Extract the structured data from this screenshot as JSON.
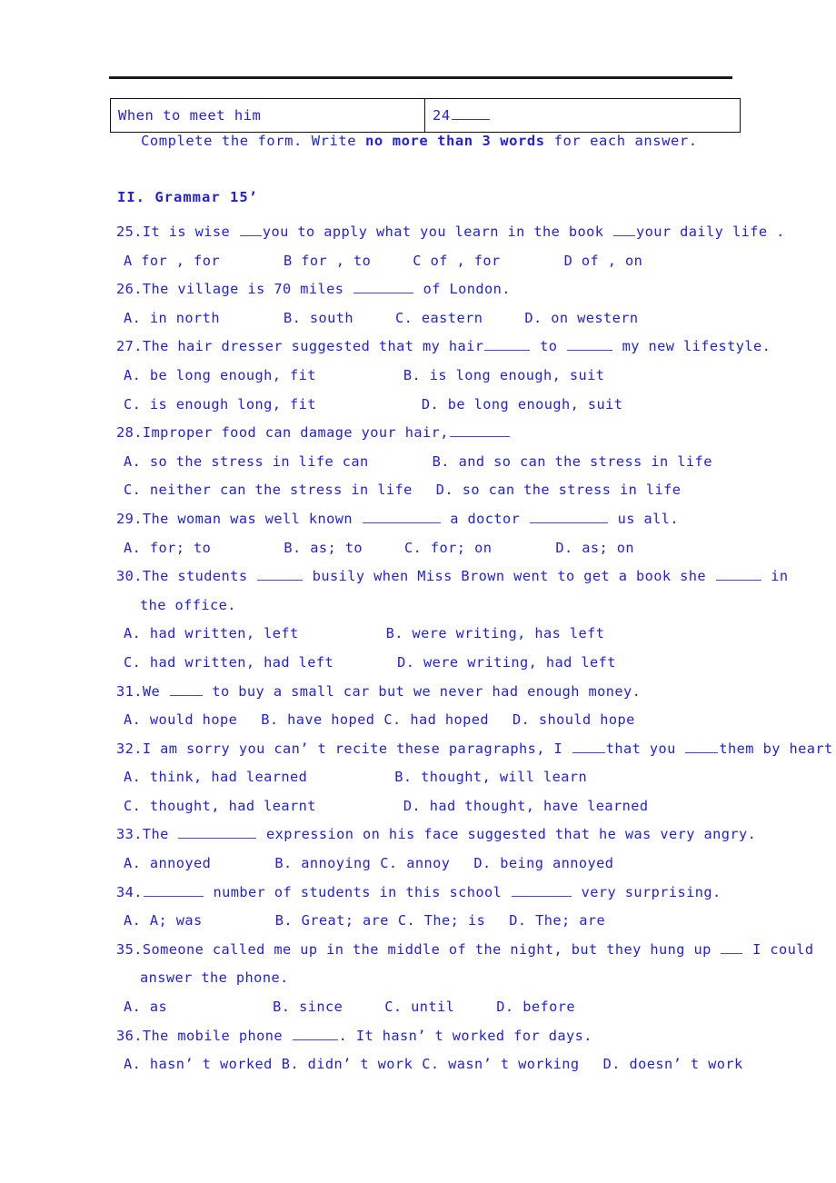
{
  "document": {
    "divider": "horizontal-rule",
    "text_color": "#2222dd",
    "table_border_color": "#111111"
  },
  "form_table": {
    "row": {
      "label": "When to meet him",
      "answer_number": "24"
    }
  },
  "instruction": {
    "before_bold": "Complete the form. Write ",
    "bold": "no more than 3 words",
    "after_bold": " for each answer."
  },
  "section": {
    "heading": "II. Grammar  15’"
  },
  "questions": [
    {
      "number": "25.",
      "stem_before": "It is wise ",
      "stem_mid": "you to apply what you learn in the book ",
      "stem_after": "your daily life .",
      "options_lines": [
        [
          {
            "label": "A",
            "text": "for , for"
          },
          {
            "label": "B",
            "text": "for , to"
          },
          {
            "label": "C",
            "text": "of , for"
          },
          {
            "label": "D",
            "text": "of , on"
          }
        ]
      ]
    },
    {
      "number": "26.",
      "stem_before": "The village is 70 miles ",
      "stem_after": " of London.",
      "options_lines": [
        [
          {
            "label": "A.",
            "text": "in north"
          },
          {
            "label": "B.",
            "text": "south"
          },
          {
            "label": "C.",
            "text": "eastern"
          },
          {
            "label": "D.",
            "text": "on western"
          }
        ]
      ]
    },
    {
      "number": "27.",
      "stem_before": "The hair dresser suggested that my hair",
      "stem_mid": " to ",
      "stem_after": " my new lifestyle.",
      "options_lines": [
        [
          {
            "label": "A.",
            "text": "be long enough, fit"
          },
          {
            "label": "B.",
            "text": "is long enough, suit"
          }
        ],
        [
          {
            "label": "C.",
            "text": "is enough long, fit"
          },
          {
            "label": "D.",
            "text": "be long enough, suit"
          }
        ]
      ]
    },
    {
      "number": "28.",
      "stem_before": "Improper food can damage your hair,",
      "stem_after": "",
      "options_lines": [
        [
          {
            "label": "A.",
            "text": "so the stress in life can"
          },
          {
            "label": "B.",
            "text": "and so can the stress in life"
          }
        ],
        [
          {
            "label": "C.",
            "text": "neither can the stress in life"
          },
          {
            "label": "D.",
            "text": "so can the stress in life"
          }
        ]
      ]
    },
    {
      "number": "29.",
      "stem_before": "The woman was well known ",
      "stem_mid": " a doctor ",
      "stem_after": " us all.",
      "options_lines": [
        [
          {
            "label": "A.",
            "text": "for; to"
          },
          {
            "label": "B.",
            "text": "as; to"
          },
          {
            "label": "C.",
            "text": "for; on"
          },
          {
            "label": "D.",
            "text": "as; on"
          }
        ]
      ]
    },
    {
      "number": "30.",
      "stem_before": "The students ",
      "stem_mid": " busily when Miss Brown went to get a book she ",
      "stem_after": " in",
      "continuation": "the office.",
      "options_lines": [
        [
          {
            "label": "A.",
            "text": "had written, left"
          },
          {
            "label": "B.",
            "text": "were writing, has left"
          }
        ],
        [
          {
            "label": "C.",
            "text": "had written, had left"
          },
          {
            "label": "D.",
            "text": "were writing, had left"
          }
        ]
      ]
    },
    {
      "number": "31.",
      "stem_before": "We ",
      "stem_after": " to buy a small car but we never had enough money.",
      "options_lines": [
        [
          {
            "label": "A.",
            "text": "would hope"
          },
          {
            "label": "B.",
            "text": "have hoped"
          },
          {
            "label": "C.",
            "text": "had hoped"
          },
          {
            "label": "D.",
            "text": "should hope"
          }
        ]
      ]
    },
    {
      "number": "32.",
      "stem_before": "I am sorry you can’ t recite these paragraphs, I ",
      "stem_mid": "that you ",
      "stem_after": "them by heart.",
      "options_lines": [
        [
          {
            "label": "A.",
            "text": "think, had learned"
          },
          {
            "label": "B.",
            "text": "thought, will learn"
          }
        ],
        [
          {
            "label": "C.",
            "text": "thought, had learnt"
          },
          {
            "label": "D.",
            "text": "had thought, have learned"
          }
        ]
      ]
    },
    {
      "number": "33.",
      "stem_before": "The ",
      "stem_after": " expression on his face suggested that he was very angry.",
      "options_lines": [
        [
          {
            "label": "A.",
            "text": "annoyed"
          },
          {
            "label": "B.",
            "text": "annoying"
          },
          {
            "label": "C.",
            "text": "annoy"
          },
          {
            "label": "D.",
            "text": "being annoyed"
          }
        ]
      ]
    },
    {
      "number": "34.",
      "stem_before": "",
      "stem_mid": " number of students in this school ",
      "stem_after": " very surprising.",
      "options_lines": [
        [
          {
            "label": "A.",
            "text": "A; was"
          },
          {
            "label": "B.",
            "text": "Great; are"
          },
          {
            "label": "C.",
            "text": "The; is"
          },
          {
            "label": "D.",
            "text": "The; are"
          }
        ]
      ]
    },
    {
      "number": "35.",
      "stem_before": "Someone called me up in the middle of the night, but they hung up ",
      "stem_after": " I could",
      "continuation": "answer the phone.",
      "options_lines": [
        [
          {
            "label": "A.",
            "text": "as"
          },
          {
            "label": "B.",
            "text": "since"
          },
          {
            "label": "C.",
            "text": "until"
          },
          {
            "label": "D.",
            "text": "before"
          }
        ]
      ]
    },
    {
      "number": "36.",
      "stem_before": "The mobile phone ",
      "stem_after": ". It hasn’ t worked for days.",
      "options_lines": [
        [
          {
            "label": "A.",
            "text": "hasn’ t worked"
          },
          {
            "label": "B.",
            "text": "didn’ t work"
          },
          {
            "label": "C.",
            "text": "wasn’ t working"
          },
          {
            "label": "D.",
            "text": "doesn’ t work"
          }
        ]
      ]
    }
  ]
}
